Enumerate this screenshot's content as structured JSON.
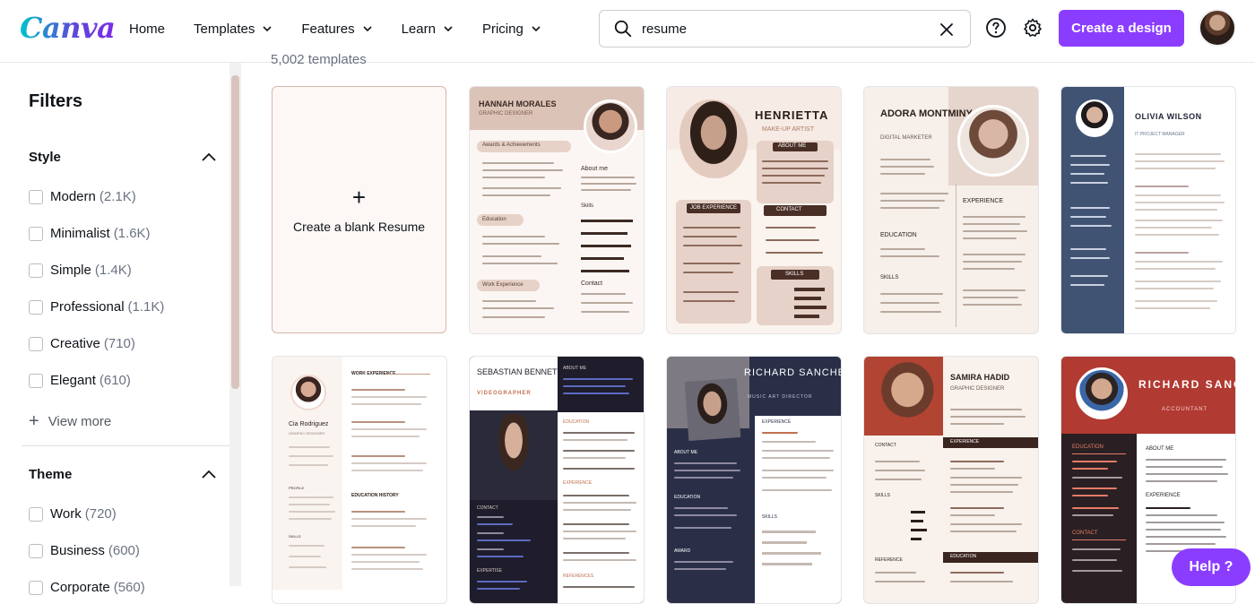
{
  "header": {
    "logo": "Canva",
    "nav": [
      {
        "label": "Home",
        "has_menu": false
      },
      {
        "label": "Templates",
        "has_menu": true
      },
      {
        "label": "Features",
        "has_menu": true
      },
      {
        "label": "Learn",
        "has_menu": true
      },
      {
        "label": "Pricing",
        "has_menu": true
      }
    ],
    "search": {
      "value": "resume"
    },
    "create_button": "Create a design",
    "help_icon": "question-circle-icon",
    "settings_icon": "gear-icon"
  },
  "sidebar": {
    "title": "Filters",
    "sections": [
      {
        "title": "Style",
        "expanded": true,
        "options": [
          {
            "label": "Modern",
            "count": "(2.1K)"
          },
          {
            "label": "Minimalist",
            "count": "(1.6K)"
          },
          {
            "label": "Simple",
            "count": "(1.4K)"
          },
          {
            "label": "Professional",
            "count": "(1.1K)"
          },
          {
            "label": "Creative",
            "count": "(710)"
          },
          {
            "label": "Elegant",
            "count": "(610)"
          }
        ],
        "view_more": "View more"
      },
      {
        "title": "Theme",
        "expanded": true,
        "options": [
          {
            "label": "Work",
            "count": "(720)"
          },
          {
            "label": "Business",
            "count": "(600)"
          },
          {
            "label": "Corporate",
            "count": "(560)"
          }
        ]
      }
    ]
  },
  "main": {
    "result_count": "5,002 templates",
    "blank_card_label": "Create a blank Resume",
    "templates": [
      {
        "name": "HANNAH MORALES",
        "subtitle": "GRAPHIC DESIGNER",
        "sections": [
          "Awards & Achievements",
          "About me",
          "Education",
          "Skills",
          "Work Experience",
          "Contact"
        ]
      },
      {
        "name": "HENRIETTA",
        "subtitle": "MAKE-UP ARTIST",
        "sections": [
          "ABOUT ME",
          "JOB EXPERIENCE",
          "CONTACT",
          "SKILLS"
        ]
      },
      {
        "name": "ADORA MONTMINY",
        "subtitle": "DIGITAL MARKETER",
        "sections": [
          "EXPERIENCE",
          "EDUCATION",
          "SKILLS"
        ]
      },
      {
        "name": "OLIVIA WILSON",
        "subtitle": "IT PROJECT MANAGER",
        "sections": []
      },
      {
        "name": "Cia Rodriguez",
        "subtitle": "GRAPHIC DESIGNER",
        "sections": [
          "WORK EXPERIENCE",
          "EDUCATION HISTORY",
          "PROFILE",
          "SKILLS"
        ]
      },
      {
        "name": "SEBASTIAN BENNETT",
        "subtitle": "VIDEOGRAPHER",
        "sections": [
          "ABOUT ME",
          "EDUCATION",
          "EXPERIENCE",
          "CONTACT",
          "EXPERTISE",
          "REFERENCES"
        ]
      },
      {
        "name": "RICHARD SANCHEZ",
        "subtitle": "MUSIC ART DIRECTOR",
        "sections": [
          "EXPERIENCE",
          "ABOUT ME",
          "EDUCATION",
          "SKILLS",
          "AWARD"
        ]
      },
      {
        "name": "SAMIRA HADID",
        "subtitle": "GRAPHIC DESIGNER",
        "sections": [
          "EXPERIENCE",
          "CONTACT",
          "SKILLS",
          "EDUCATION",
          "REFERENCE"
        ]
      },
      {
        "name": "RICHARD SANCHEZ",
        "subtitle": "ACCOUNTANT",
        "sections": [
          "EDUCATION",
          "ABOUT ME",
          "EXPERIENCE",
          "CONTACT"
        ]
      }
    ]
  },
  "help": {
    "label": "Help ?"
  },
  "colors": {
    "brand_purple": "#8b3dff",
    "blush": "#e8d6cf",
    "navy": "#1f2a44",
    "red": "#b33a32"
  }
}
